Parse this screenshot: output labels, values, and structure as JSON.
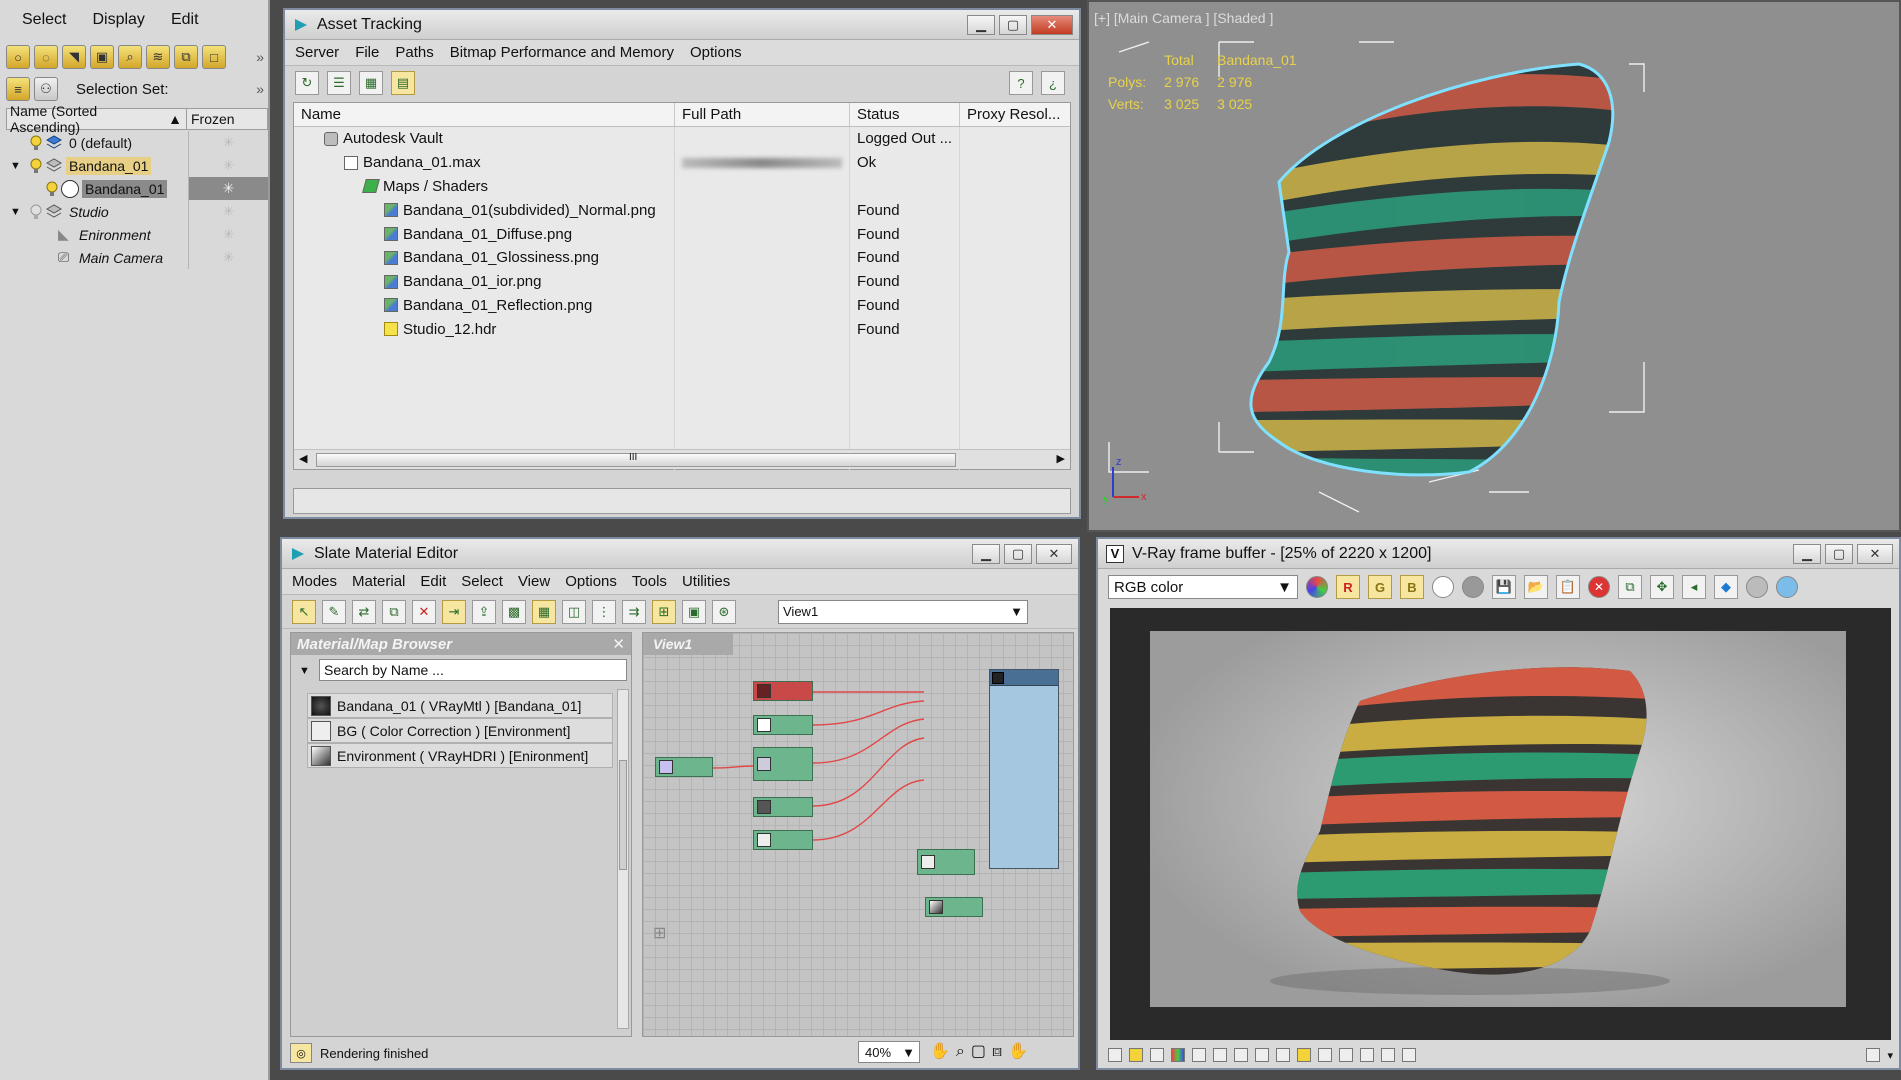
{
  "scene_explorer": {
    "menu": [
      "Select",
      "Display",
      "Edit"
    ],
    "selection_set_label": "Selection Set:",
    "col_name": "Name (Sorted Ascending)",
    "col_frozen": "Frozen",
    "rows": [
      {
        "label": "0 (default)"
      },
      {
        "label": "Bandana_01"
      },
      {
        "label": "Bandana_01"
      },
      {
        "label": "Studio"
      },
      {
        "label": "Enironment"
      },
      {
        "label": "Main Camera"
      }
    ]
  },
  "asset_tracking": {
    "title": "Asset Tracking",
    "menu": [
      "Server",
      "File",
      "Paths",
      "Bitmap Performance and Memory",
      "Options"
    ],
    "columns": [
      "Name",
      "Full Path",
      "Status",
      "Proxy Resol..."
    ],
    "rows": [
      {
        "name": "Autodesk Vault",
        "status": "Logged Out ..."
      },
      {
        "name": "Bandana_01.max",
        "status": "Ok"
      },
      {
        "name": "Maps / Shaders",
        "status": ""
      },
      {
        "name": "Bandana_01(subdivided)_Normal.png",
        "status": "Found"
      },
      {
        "name": "Bandana_01_Diffuse.png",
        "status": "Found"
      },
      {
        "name": "Bandana_01_Glossiness.png",
        "status": "Found"
      },
      {
        "name": "Bandana_01_ior.png",
        "status": "Found"
      },
      {
        "name": "Bandana_01_Reflection.png",
        "status": "Found"
      },
      {
        "name": "Studio_12.hdr",
        "status": "Found"
      }
    ],
    "scroll_grip": "III"
  },
  "viewport": {
    "label": "[+] [Main Camera ] [Shaded ]",
    "stats_header_total": "Total",
    "stats_header_object": "Bandana_01",
    "polys_label": "Polys:",
    "polys_total": "2 976",
    "polys_object": "2 976",
    "verts_label": "Verts:",
    "verts_total": "3 025",
    "verts_object": "3 025"
  },
  "slate": {
    "title": "Slate Material Editor",
    "menu": [
      "Modes",
      "Material",
      "Edit",
      "Select",
      "View",
      "Options",
      "Tools",
      "Utilities"
    ],
    "view_select": "View1",
    "browser_title": "Material/Map Browser",
    "search_placeholder": "Search by Name ...",
    "materials": [
      "Bandana_01  ( VRayMtl )  [Bandana_01]",
      "BG  ( Color Correction )  [Environment]",
      "Environment  ( VRayHDRI )  [Enironment]"
    ],
    "view_tab": "View1",
    "status": "Rendering finished",
    "zoom": "40%"
  },
  "vfb": {
    "title": "V-Ray frame buffer - [25% of 2220 x 1200]",
    "channel": "RGB color",
    "btn_r": "R",
    "btn_g": "G",
    "btn_b": "B"
  },
  "colors": {
    "accent_yellow": "#e8d24a",
    "selection": "#e7cf86",
    "node_green": "#6cb58d",
    "close_red": "#c23b22"
  }
}
